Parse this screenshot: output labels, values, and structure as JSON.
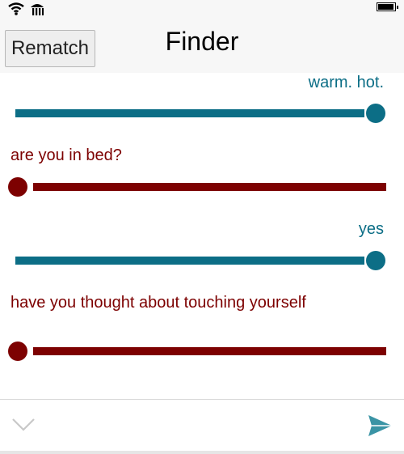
{
  "status_bar": {
    "icons": [
      "wifi-icon",
      "signal-icon",
      "battery-icon"
    ]
  },
  "header": {
    "title": "Finder",
    "rematch_label": "Rematch"
  },
  "messages": [
    {
      "text": "warm. hot.",
      "side": "right",
      "color": "#0c6e86"
    },
    {
      "slider_value": 1.0,
      "side": "right",
      "color": "#0c6e86"
    },
    {
      "text": "are you in bed?",
      "side": "left",
      "color": "#7d0101"
    },
    {
      "slider_value": 0.0,
      "side": "left",
      "color": "#7d0101"
    },
    {
      "text": "yes",
      "side": "right",
      "color": "#0c6e86"
    },
    {
      "slider_value": 1.0,
      "side": "right",
      "color": "#0c6e86"
    },
    {
      "text": "have you thought about touching yourself",
      "side": "left",
      "color": "#7d0101"
    },
    {
      "slider_value": 0.0,
      "side": "left",
      "color": "#7d0101"
    }
  ],
  "composer": {
    "expand_icon": "chevron-down-icon",
    "send_icon": "send-icon"
  },
  "colors": {
    "self": "#0c6e86",
    "partner": "#7d0101",
    "header_bg": "#f7f7f7"
  }
}
